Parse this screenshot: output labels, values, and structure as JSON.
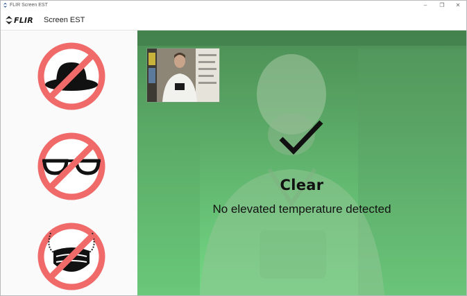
{
  "window": {
    "title": "FLIR Screen EST",
    "controls": {
      "minimize": "–",
      "maximize": "❐",
      "close": "✕"
    }
  },
  "header": {
    "logo_text": "FLIR",
    "app_name": "Screen EST"
  },
  "sidebar": {
    "rules": [
      {
        "icon": "no-hat-icon"
      },
      {
        "icon": "no-glasses-icon"
      },
      {
        "icon": "no-mask-icon"
      }
    ]
  },
  "main": {
    "status_icon": "checkmark-icon",
    "status_title": "Clear",
    "status_message": "No elevated temperature detected"
  },
  "colors": {
    "prohibit_red": "#f06a6a",
    "status_green_top": "#4c8e55",
    "status_green_bottom": "#73d985",
    "text_dark": "#111111"
  }
}
